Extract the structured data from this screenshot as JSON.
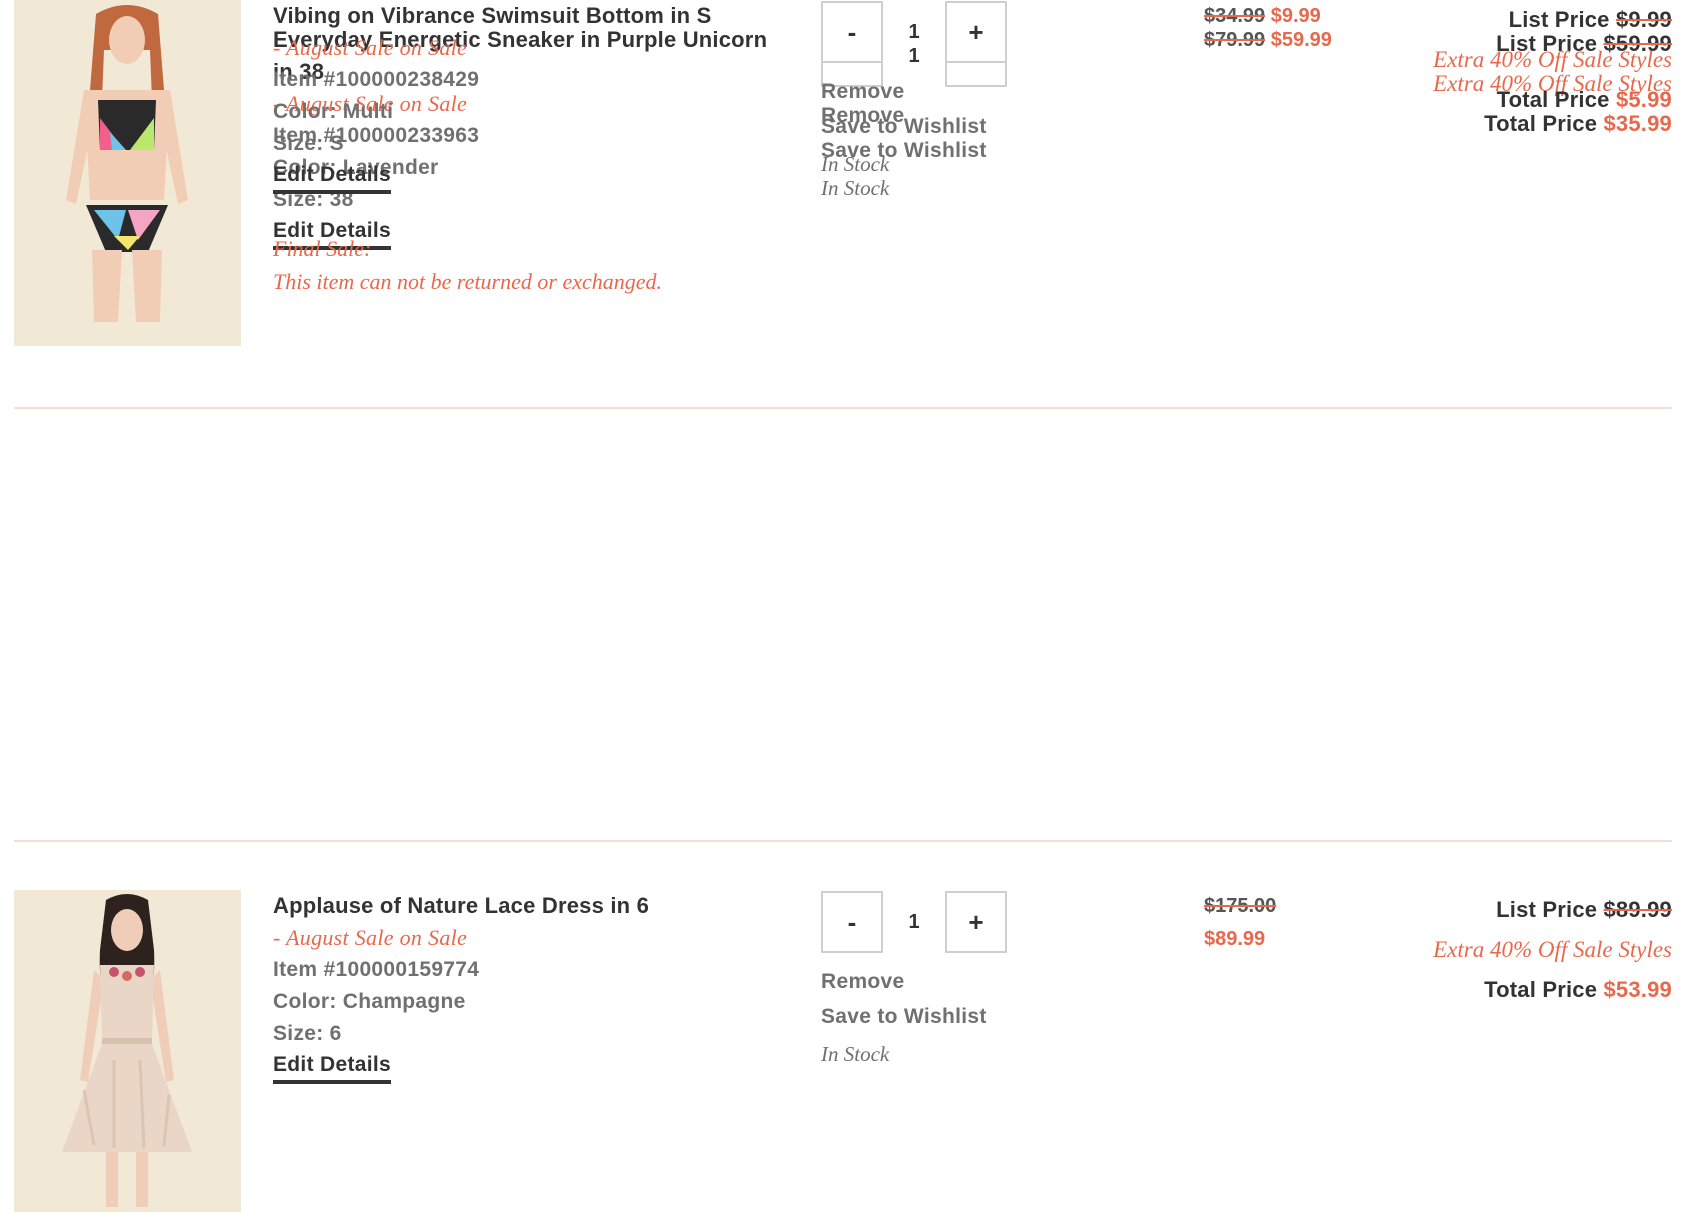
{
  "labels": {
    "remove": "Remove",
    "save_to_wishlist": "Save to Wishlist",
    "edit_details": "Edit Details",
    "list_price": "List Price",
    "total_price": "Total Price",
    "minus": "-",
    "plus": "+"
  },
  "items": [
    {
      "name": "Everyday Energetic Sneaker in Purple Unicorn in 38",
      "sale_note": "- August Sale on Sale",
      "item_number": "Item #100000233963",
      "color": "Color: Lavender",
      "size": "Size: 38",
      "quantity": "1",
      "stock": "In Stock",
      "original_price": "$79.99",
      "sale_price": "$59.99",
      "list_price": "$59.99",
      "promo": "Extra 40% Off Sale Styles",
      "total_price": "$35.99",
      "image": "sneaker-image"
    },
    {
      "name": "Applause of Nature Lace Dress in 6",
      "sale_note": "- August Sale on Sale",
      "item_number": "Item #100000159774",
      "color": "Color: Champagne",
      "size": "Size: 6",
      "quantity": "1",
      "stock": "In Stock",
      "original_price": "$175.00",
      "sale_price": "$89.99",
      "list_price": "$89.99",
      "promo": "Extra 40% Off Sale Styles",
      "total_price": "$53.99",
      "image": "dress-image"
    },
    {
      "name": "Vibing on Vibrance Swimsuit Bottom in S",
      "sale_note": "- August Sale on Sale",
      "item_number": "Item #100000238429",
      "color": "Color: Multi",
      "size": "Size: S",
      "quantity": "1",
      "stock": "In Stock",
      "original_price": "$34.99",
      "sale_price": "$9.99",
      "list_price": "$9.99",
      "promo": "Extra 40% Off Sale Styles",
      "total_price": "$5.99",
      "final_sale_title": "Final Sale:",
      "final_sale_text": "This item can not be returned or exchanged.",
      "image": "swimsuit-image"
    }
  ],
  "colors": {
    "accent": "#e8684c",
    "text_dark": "#333333",
    "text_muted": "#707070",
    "divider": "#f6ddd4",
    "image_background": "#f2ead7"
  }
}
